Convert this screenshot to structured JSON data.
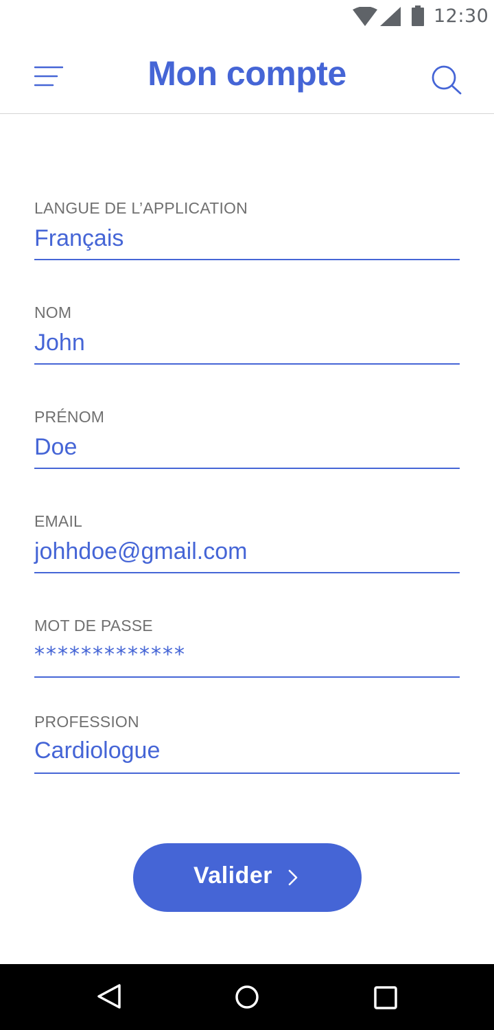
{
  "status_bar": {
    "time": "12:30",
    "icons": [
      "wifi-icon",
      "signal-icon",
      "battery-icon"
    ]
  },
  "header": {
    "title": "Mon compte",
    "menu_icon": "menu-icon",
    "search_icon": "search-icon"
  },
  "form": {
    "fields": [
      {
        "label": "LANGUE DE L’APPLICATION",
        "value": "Français"
      },
      {
        "label": "NOM",
        "value": "John"
      },
      {
        "label": "PRÉNOM",
        "value": "Doe"
      },
      {
        "label": "EMAIL",
        "value": "johhdoe@gmail.com"
      },
      {
        "label": "MOT DE PASSE",
        "value": "*************"
      },
      {
        "label": "PROFESSION",
        "value": "Cardiologue"
      }
    ]
  },
  "submit": {
    "label": "Valider",
    "icon": "chevron-right-icon"
  },
  "nav_bar": {
    "icons": [
      "back-icon",
      "home-icon",
      "recents-icon"
    ]
  },
  "colors": {
    "accent": "#4565d6",
    "label": "#707070",
    "divider": "#d4d4d4",
    "nav_background": "#000000"
  }
}
